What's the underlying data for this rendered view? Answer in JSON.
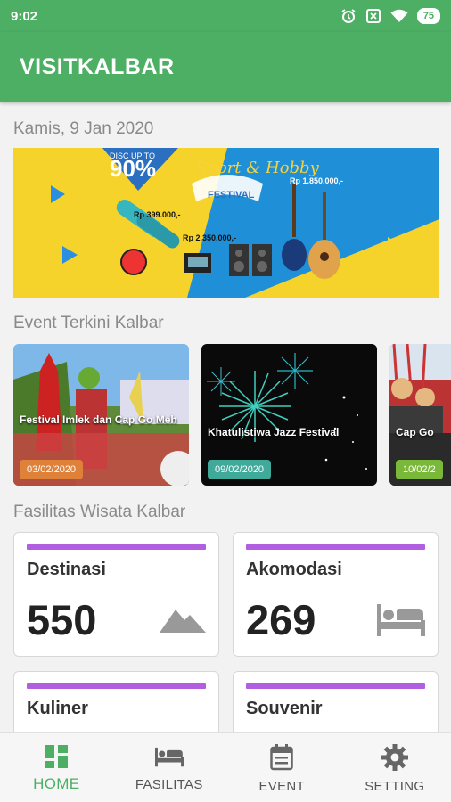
{
  "status_bar": {
    "time": "9:02",
    "battery": "75"
  },
  "app_bar": {
    "title": "VISITKALBAR"
  },
  "date_label": "Kamis, 9 Jan 2020",
  "banner": {
    "badge": "90%",
    "badge_small": "DISC UP TO",
    "festival_title": "Sport & Hobby",
    "festival_sub": "FESTIVAL",
    "prices": [
      "Rp 399.000,-",
      "Rp 2.350.000,-",
      "Rp 1.850.000,-"
    ]
  },
  "events_section": {
    "title": "Event Terkini Kalbar",
    "items": [
      {
        "title": "Festival Imlek dan Cap Go Meh",
        "date": "03/02/2020"
      },
      {
        "title": "Khatulistiwa Jazz Festival",
        "date": "09/02/2020"
      },
      {
        "title": "Cap Go",
        "date": "10/02/2"
      }
    ]
  },
  "facilities_section": {
    "title": "Fasilitas Wisata Kalbar",
    "items": [
      {
        "name": "Destinasi",
        "count": "550",
        "icon": "mountain-icon"
      },
      {
        "name": "Akomodasi",
        "count": "269",
        "icon": "bed-icon"
      },
      {
        "name": "Kuliner",
        "count": "",
        "icon": ""
      },
      {
        "name": "Souvenir",
        "count": "",
        "icon": ""
      }
    ]
  },
  "bottom_nav": {
    "items": [
      {
        "label": "HOME",
        "icon": "dashboard-icon",
        "active": true
      },
      {
        "label": "FASILITAS",
        "icon": "bed-icon",
        "active": false
      },
      {
        "label": "EVENT",
        "icon": "calendar-icon",
        "active": false
      },
      {
        "label": "SETTING",
        "icon": "gear-icon",
        "active": false
      }
    ]
  },
  "colors": {
    "primary": "#4caf64",
    "card_accent": "#b15fe0",
    "muted_text": "#8a8a8a"
  }
}
